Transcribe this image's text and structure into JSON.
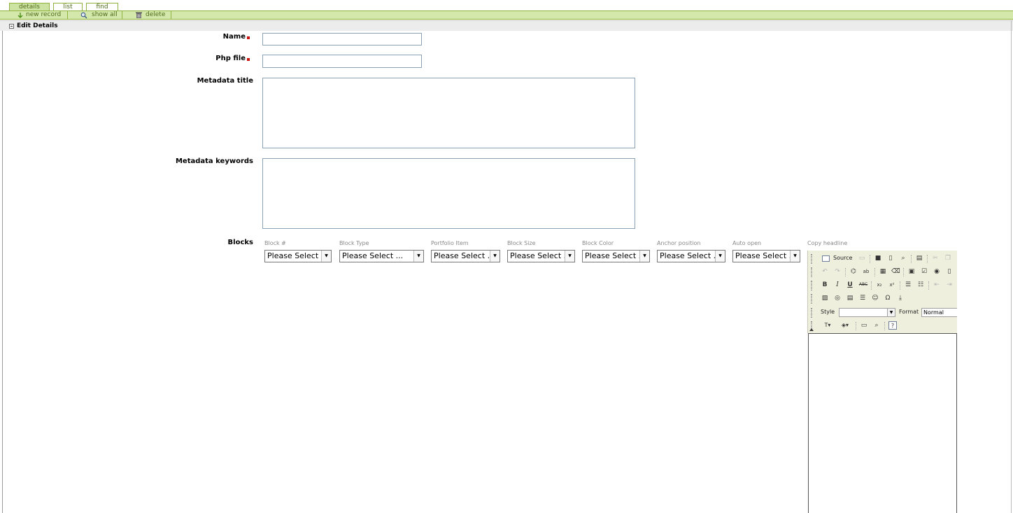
{
  "tabs": [
    {
      "label": "details",
      "active": true
    },
    {
      "label": "list",
      "active": false
    },
    {
      "label": "find",
      "active": false
    }
  ],
  "toolbar": {
    "new_record": "new record",
    "show_all": "show all",
    "delete": "delete"
  },
  "section": {
    "title": "Edit Details"
  },
  "form": {
    "name_label": "Name",
    "name_value": "",
    "php_label": "Php file",
    "php_value": "",
    "meta_title_label": "Metadata title",
    "meta_title_value": "",
    "meta_keywords_label": "Metadata keywords",
    "meta_keywords_value": "",
    "blocks_label": "Blocks"
  },
  "blocks": {
    "columns": [
      {
        "header": "Block #",
        "selected": "Please Select ..."
      },
      {
        "header": "Block Type",
        "selected": "Please Select ..."
      },
      {
        "header": "Portfolio Item",
        "selected": "Please Select ..."
      },
      {
        "header": "Block Size",
        "selected": "Please Select ..."
      },
      {
        "header": "Block Color",
        "selected": "Please Select ..."
      },
      {
        "header": "Anchor position",
        "selected": "Please Select ..."
      },
      {
        "header": "Auto open",
        "selected": "Please Select ..."
      }
    ],
    "copy_headline_label": "Copy headline"
  },
  "editor": {
    "source_label": "Source",
    "style_label": "Style",
    "style_value": "",
    "format_label": "Format",
    "format_value": "Normal",
    "bold": "B",
    "italic": "I",
    "underline": "U",
    "strike": "ABC"
  },
  "colors": {
    "tab_border": "#8fb23f",
    "toolbar_bg": "#d4e8ab",
    "required_marker": "#cc1111"
  }
}
